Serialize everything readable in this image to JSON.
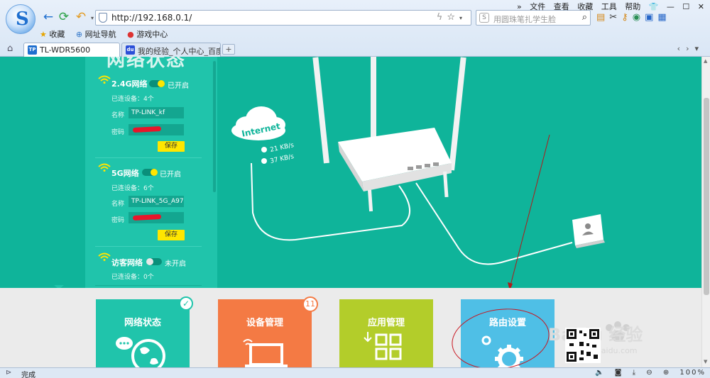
{
  "browser": {
    "url": "http://192.168.0.1/",
    "search_placeholder": "用圆珠笔扎学生脸",
    "menu": [
      "文件",
      "查看",
      "收藏",
      "工具",
      "帮助"
    ],
    "bookmarks": [
      "收藏",
      "网址导航",
      "游戏中心"
    ],
    "tabs": [
      {
        "label": "TL-WDR5600",
        "active": true
      },
      {
        "label": "我的经验_个人中心_百度",
        "active": false
      }
    ],
    "status": "完成",
    "zoom": "100%"
  },
  "page": {
    "heading": "网络状态",
    "networks": [
      {
        "name": "2.4G网络",
        "state": "已开启",
        "on": true,
        "devices": "已连设备：4个",
        "ssid_label": "名称",
        "ssid": "TP-LINK_kf",
        "pwd_label": "密码",
        "save": "保存"
      },
      {
        "name": "5G网络",
        "state": "已开启",
        "on": true,
        "devices": "已连设备：6个",
        "ssid_label": "名称",
        "ssid": "TP-LINK_5G_A97F",
        "pwd_label": "密码",
        "save": "保存"
      },
      {
        "name": "访客网络",
        "state": "未开启",
        "on": false,
        "devices": "已连设备：0个"
      }
    ],
    "diagram": {
      "internet_label": "Internet",
      "upload": "21 KB/s",
      "download": "37 KB/s"
    },
    "tiles": [
      {
        "label": "网络状态",
        "color": "#20c4ab"
      },
      {
        "label": "设备管理",
        "color": "#f47a44",
        "badge": "11"
      },
      {
        "label": "应用管理",
        "color": "#b3cd2a"
      },
      {
        "label": "路由设置",
        "color": "#4fbfe6"
      }
    ],
    "watermark": "Baidu 经验",
    "watermark_sub": "jingyan.baidu.com"
  }
}
